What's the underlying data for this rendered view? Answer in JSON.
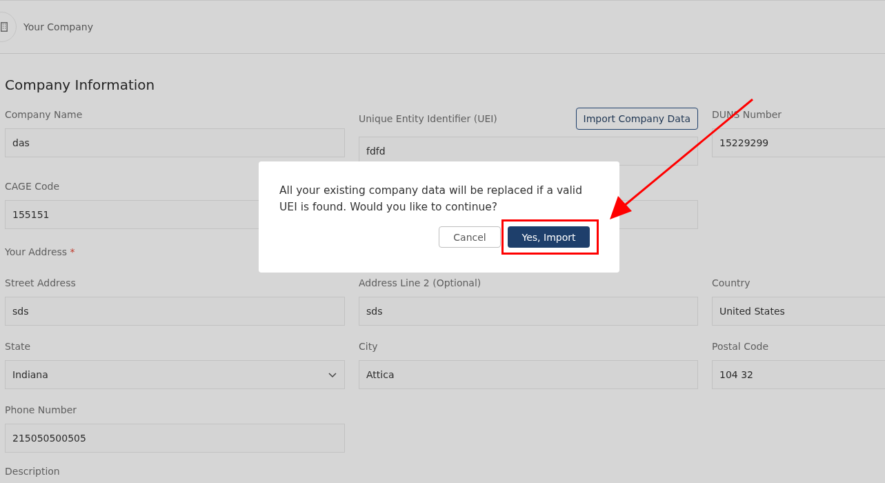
{
  "header": {
    "title": "Your Company"
  },
  "section_title": "Company Information",
  "rows": [
    [
      {
        "kind": "text",
        "label": "Company Name",
        "value": "das"
      },
      {
        "kind": "text",
        "label": "Unique Entity Identifier (UEI)",
        "value": "fdfd",
        "action": "Import Company Data"
      },
      {
        "kind": "text",
        "label": "DUNS Number",
        "value": "15229299"
      }
    ],
    [
      {
        "kind": "text",
        "label": "CAGE Code",
        "value": "155151"
      },
      {
        "kind": "text"
      },
      {
        "kind": "empty"
      }
    ]
  ],
  "address_label": {
    "text": "Your Address",
    "required_mark": "*"
  },
  "address_rows": [
    [
      {
        "kind": "text",
        "label": "Street Address",
        "value": "sds"
      },
      {
        "kind": "text",
        "label": "Address Line 2 (Optional)",
        "value": "sds"
      },
      {
        "kind": "text",
        "label": "Country",
        "value": "United States"
      }
    ],
    [
      {
        "kind": "select",
        "label": "State",
        "value": "Indiana"
      },
      {
        "kind": "text",
        "label": "City",
        "value": "Attica"
      },
      {
        "kind": "text",
        "label": "Postal Code",
        "value": "104 32"
      }
    ],
    [
      {
        "kind": "text",
        "label": "Phone Number",
        "value": "215050500505"
      }
    ]
  ],
  "next_label": "Description",
  "dialog": {
    "message": "All your existing company data will be replaced if a valid UEI is found. Would you like to continue?",
    "buttons": [
      {
        "label": "Cancel",
        "kind": "secondary",
        "highlighted": false
      },
      {
        "label": "Yes, Import",
        "kind": "primary",
        "highlighted": true
      }
    ]
  }
}
